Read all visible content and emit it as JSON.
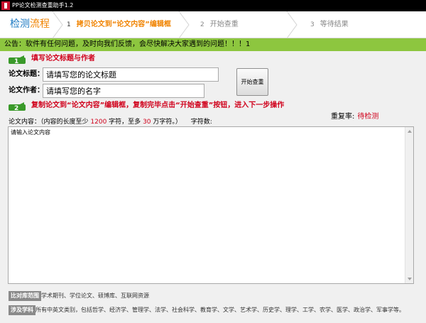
{
  "window": {
    "title": "PP论文检测查重助手1.2"
  },
  "steps": {
    "brand_part1": "检测",
    "brand_part2": "流程",
    "items": [
      {
        "num": "1",
        "label": "拷贝论文到“论文内容”编辑框"
      },
      {
        "num": "2",
        "label": "开始查重"
      },
      {
        "num": "3",
        "label": "等待结果"
      }
    ]
  },
  "notice": {
    "text": "公告：软件有任何问题，及时向我们反馈，会尽快解决大家遇到的问题！！！1"
  },
  "section1": {
    "title": "填写论文标题与作者",
    "title_label": "论文标题：",
    "title_value": "请填写您的论文标题",
    "author_label": "论文作者：",
    "author_value": "请填写您的名字",
    "check_button": "开始查重"
  },
  "section2": {
    "title": "复制论文到“论文内容”编辑框，复制完毕点击“开始查重”按钮，进入下一步操作"
  },
  "duplicate_rate": {
    "label": "重复率:",
    "value": "待检测"
  },
  "content": {
    "hint_prefix": "论文内容：（内容的长度至少",
    "min_chars": "1200",
    "hint_mid1": "字符，至多",
    "max_chars": "30",
    "hint_mid2": "万字符。）",
    "char_count_label": "字符数:",
    "placeholder": "请输入论文内容"
  },
  "footer": {
    "compare_tag": "比对库范围",
    "compare_text": "学术期刊、学位论文、硕博库、互联网资源",
    "subject_tag": "涉及学科",
    "subject_text": "所有中英文类别，包括哲学、经济学、管理学、法学、社会科学、教育学、文学、艺术学、历史学、理学、工学、农学、医学、政治学、军事学等。"
  },
  "colors": {
    "brand_blue": "#1a78c2",
    "accent_orange": "#f08300",
    "notice_green": "#8dc63f",
    "alert_red": "#d0001b",
    "badge_green": "#3a9a2a"
  }
}
